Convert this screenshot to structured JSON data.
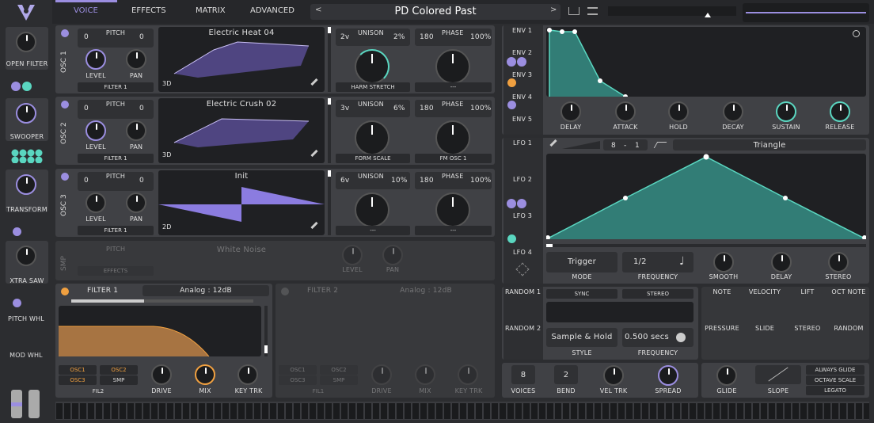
{
  "nav": {
    "tabs": [
      "VOICE",
      "EFFECTS",
      "MATRIX",
      "ADVANCED"
    ],
    "preset": "PD Colored Past"
  },
  "macros": [
    {
      "label": "OPEN FILTER"
    },
    {
      "label": "SWOOPER"
    },
    {
      "label": "TRANSFORM"
    },
    {
      "label": "XTRA SAW"
    },
    {
      "label": "PITCH WHL"
    },
    {
      "label": "MOD WHL"
    }
  ],
  "osc": [
    {
      "name": "OSC 1",
      "pitch_label": "PITCH",
      "pitch_left": "0",
      "pitch_right": "0",
      "wavetable": "Electric Heat 04",
      "dim": "3D",
      "unison_label": "UNISON",
      "voices": "2v",
      "detune": "2%",
      "phase_label": "PHASE",
      "phase": "180",
      "phase_rand": "100%",
      "level": "LEVEL",
      "pan": "PAN",
      "dest": "FILTER 1",
      "mod1": "HARM STRETCH",
      "mod2": "---"
    },
    {
      "name": "OSC 2",
      "pitch_label": "PITCH",
      "pitch_left": "0",
      "pitch_right": "0",
      "wavetable": "Electric Crush 02",
      "dim": "3D",
      "unison_label": "UNISON",
      "voices": "3v",
      "detune": "6%",
      "phase_label": "PHASE",
      "phase": "180",
      "phase_rand": "100%",
      "level": "LEVEL",
      "pan": "PAN",
      "dest": "FILTER 1",
      "mod1": "FORM SCALE",
      "mod2": "FM OSC 1"
    },
    {
      "name": "OSC 3",
      "pitch_label": "PITCH",
      "pitch_left": "0",
      "pitch_right": "0",
      "wavetable": "Init",
      "dim": "2D",
      "unison_label": "UNISON",
      "voices": "6v",
      "detune": "10%",
      "phase_label": "PHASE",
      "phase": "180",
      "phase_rand": "100%",
      "level": "LEVEL",
      "pan": "PAN",
      "dest": "FILTER 1",
      "mod1": "---",
      "mod2": "---"
    }
  ],
  "smp": {
    "name": "SMP",
    "pitch": "PITCH",
    "sample": "White Noise",
    "level": "LEVEL",
    "pan": "PAN",
    "dest": "EFFECTS"
  },
  "filter1": {
    "name": "FILTER 1",
    "type": "Analog : 12dB",
    "routes": [
      "OSC1",
      "OSC2",
      "OSC3",
      "SMP"
    ],
    "fil2": "FIL2",
    "drive": "DRIVE",
    "mix": "MIX",
    "keytrk": "KEY TRK"
  },
  "filter2": {
    "name": "FILTER 2",
    "type": "Analog : 12dB",
    "routes": [
      "OSC1",
      "OSC2",
      "OSC3",
      "SMP"
    ],
    "fil1": "FIL1",
    "drive": "DRIVE",
    "mix": "MIX",
    "keytrk": "KEY TRK"
  },
  "env": {
    "tabs": [
      "ENV 1",
      "ENV 2",
      "ENV 3",
      "ENV 4",
      "ENV 5"
    ],
    "knobs": [
      "DELAY",
      "ATTACK",
      "HOLD",
      "DECAY",
      "SUSTAIN",
      "RELEASE"
    ]
  },
  "lfo": {
    "tabs": [
      "LFO 1",
      "LFO 2",
      "LFO 3",
      "LFO 4"
    ],
    "sync_num": "8",
    "sync_sep": "-",
    "sync_den": "1",
    "shape": "Triangle",
    "mode_val": "Trigger",
    "mode": "MODE",
    "freq_val": "1/2",
    "freq": "FREQUENCY",
    "smooth": "SMOOTH",
    "delay": "DELAY",
    "stereo": "STEREO"
  },
  "random": {
    "tabs": [
      "RANDOM 1",
      "RANDOM 2"
    ],
    "sync": "SYNC",
    "stereo": "STEREO",
    "style_val": "Sample & Hold",
    "style": "STYLE",
    "freq_val": "0.500 secs",
    "freq": "FREQUENCY"
  },
  "sources": [
    "NOTE",
    "VELOCITY",
    "LIFT",
    "OCT NOTE",
    "PRESSURE",
    "SLIDE",
    "STEREO",
    "RANDOM"
  ],
  "voice": {
    "voices_val": "8",
    "voices": "VOICES",
    "bend_val": "2",
    "bend": "BEND",
    "veltrk": "VEL TRK",
    "spread": "SPREAD",
    "glide": "GLIDE",
    "slope": "SLOPE",
    "always": "ALWAYS GLIDE",
    "octave": "OCTAVE SCALE",
    "legato": "LEGATO"
  },
  "colors": {
    "accent": "#9b8ee0",
    "teal": "#5ad6c0",
    "orange": "#f0a040"
  }
}
